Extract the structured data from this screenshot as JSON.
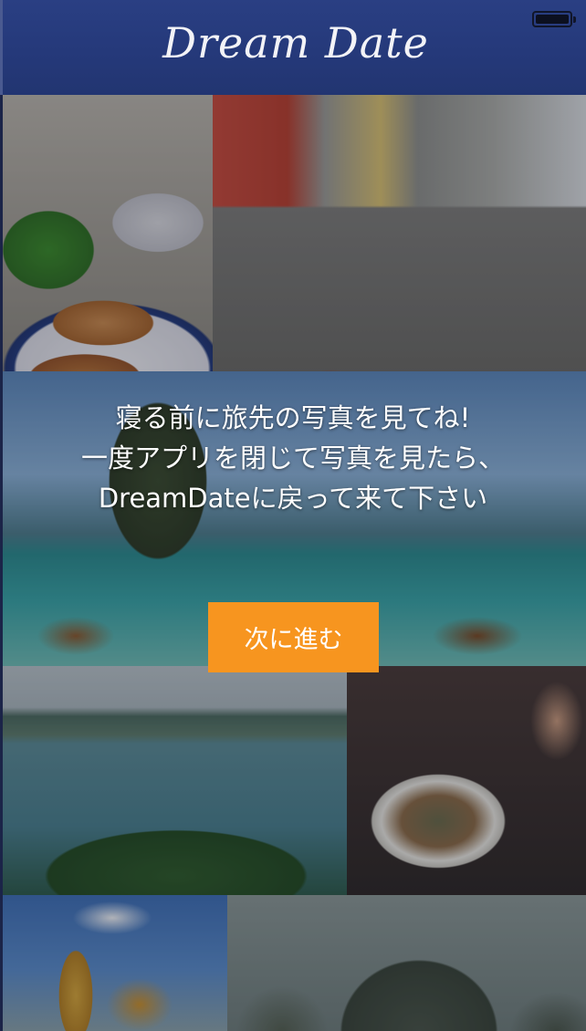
{
  "header": {
    "logo_text": "Dream Date"
  },
  "gallery": {
    "photos": [
      {
        "subject": "spring-rolls"
      },
      {
        "subject": "motorbike-street"
      },
      {
        "subject": "longtail-boats-beach"
      },
      {
        "subject": "bay-with-junk-boats"
      },
      {
        "subject": "noodle-bowl"
      },
      {
        "subject": "golden-temple"
      },
      {
        "subject": "karst-mountains"
      }
    ]
  },
  "message": {
    "lines": [
      "寝る前に旅先の写真を見てね!",
      "一度アプリを閉じて写真を見たら、",
      "DreamDateに戻って来て下さい"
    ]
  },
  "next_button": {
    "label": "次に進む",
    "color": "#f7951f"
  },
  "colors": {
    "header_bg": "#2a3f83",
    "accent": "#f7951f"
  }
}
